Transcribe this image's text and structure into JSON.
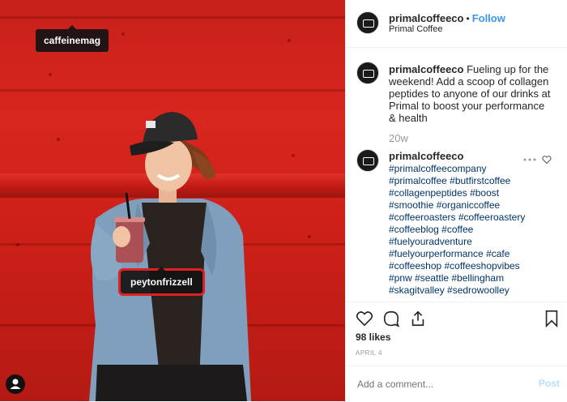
{
  "photo": {
    "tags": [
      "caffeinemag",
      "peytonfrizzell"
    ]
  },
  "header": {
    "username": "primalcoffeeco",
    "separator": "•",
    "follow_label": "Follow",
    "location": "Primal Coffee"
  },
  "caption": {
    "username": "primalcoffeeco",
    "text": "Fueling up for the weekend! Add a scoop of collagen peptides to anyone of our drinks at Primal to boost your performance & health",
    "time_ago": "20w"
  },
  "comment": {
    "username": "primalcoffeeco",
    "hashtag_lines": [
      "#primalcoffeecompany",
      "#primalcoffee #butfirstcoffee",
      "#collagenpeptides #boost",
      "#smoothie #organiccoffee",
      "#coffeeroasters #coffeeroastery",
      "#coffeeblog #coffee",
      "#fuelyouradventure",
      "#fuelyourperformance #cafe",
      "#coffeeshop #coffeeshopvibes",
      "#pnw #seattle #bellingham",
      "#skagitvalley #sedrowoolley"
    ]
  },
  "stats": {
    "likes": "98 likes",
    "date": "APRIL 4"
  },
  "composer": {
    "placeholder": "Add a comment...",
    "post_label": "Post"
  },
  "colors": {
    "accent": "#3897f0",
    "hashtag": "#003569",
    "background_red": "#d8261e"
  }
}
